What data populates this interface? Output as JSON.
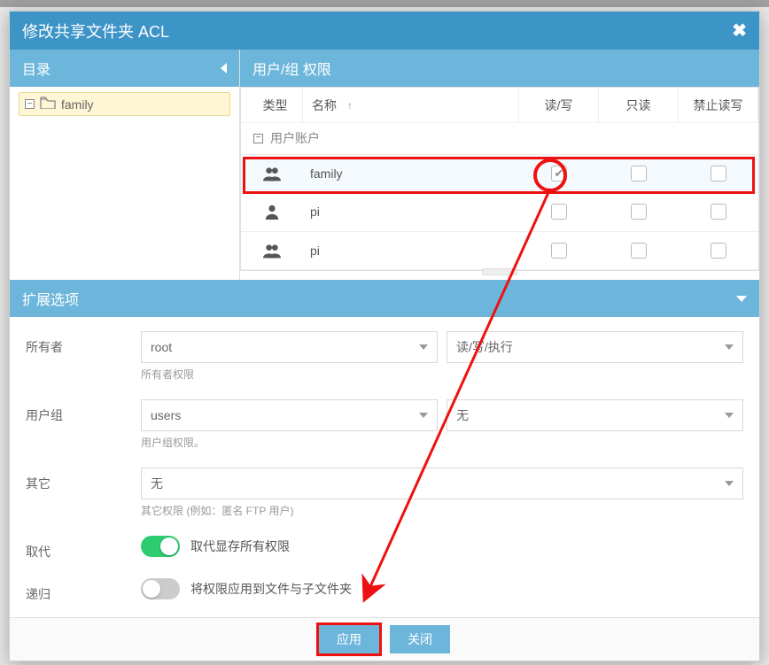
{
  "dialog": {
    "title": "修改共享文件夹 ACL"
  },
  "directory": {
    "panel_title": "目录",
    "node": {
      "name": "family"
    }
  },
  "permissions": {
    "panel_title": "用户/组 权限",
    "columns": {
      "type": "类型",
      "name": "名称",
      "rw": "读/写",
      "ro": "只读",
      "deny": "禁止读写"
    },
    "group_label": "用户账户",
    "rows": [
      {
        "icon": "group",
        "name": "family",
        "rw": true,
        "ro": false,
        "deny": false,
        "selected": true
      },
      {
        "icon": "user",
        "name": "pi",
        "rw": false,
        "ro": false,
        "deny": false,
        "selected": false
      },
      {
        "icon": "group",
        "name": "pi",
        "rw": false,
        "ro": false,
        "deny": false,
        "selected": false
      }
    ]
  },
  "extended": {
    "panel_title": "扩展选项",
    "owner_label": "所有者",
    "owner_value": "root",
    "owner_perm_value": "读/写/执行",
    "owner_hint": "所有者权限",
    "group_label": "用户组",
    "group_value": "users",
    "group_perm_value": "无",
    "group_hint": "用户组权限。",
    "other_label": "其它",
    "other_value": "无",
    "other_hint": "其它权限 (例如：匿名 FTP 用户)",
    "replace_label": "取代",
    "replace_text": "取代显存所有权限",
    "replace_on": true,
    "recurse_label": "递归",
    "recurse_text": "将权限应用到文件与子文件夹",
    "recurse_on": false
  },
  "footer": {
    "apply": "应用",
    "close": "关闭"
  }
}
